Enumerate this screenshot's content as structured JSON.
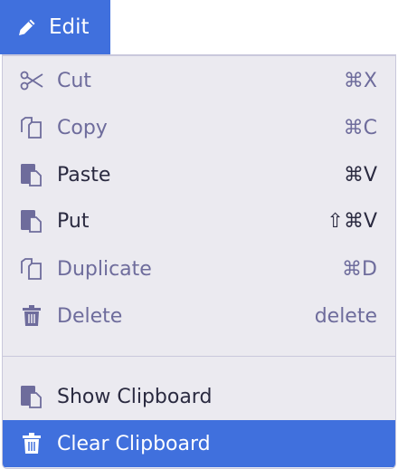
{
  "menu_button": {
    "label": "Edit",
    "icon": "pencil-icon"
  },
  "items": [
    {
      "label": "Cut",
      "shortcut": "⌘X",
      "icon": "scissors-icon",
      "disabled": true
    },
    {
      "label": "Copy",
      "shortcut": "⌘C",
      "icon": "copy-icon",
      "disabled": true
    },
    {
      "label": "Paste",
      "shortcut": "⌘V",
      "icon": "paste-icon",
      "disabled": false
    },
    {
      "label": "Put",
      "shortcut": "⇧⌘V",
      "icon": "paste-icon",
      "disabled": false
    },
    {
      "label": "Duplicate",
      "shortcut": "⌘D",
      "icon": "copy-icon",
      "disabled": true
    },
    {
      "label": "Delete",
      "shortcut": "delete",
      "icon": "trash-icon",
      "disabled": true
    }
  ],
  "clipboard_items": [
    {
      "label": "Show Clipboard",
      "icon": "paste-icon"
    },
    {
      "label": "Clear Clipboard",
      "icon": "trash-icon",
      "highlighted": true
    }
  ],
  "colors": {
    "accent": "#4070dd",
    "menu_bg": "#ebeaf0",
    "disabled_text": "#6e6c9c",
    "text": "#2a2a40"
  }
}
